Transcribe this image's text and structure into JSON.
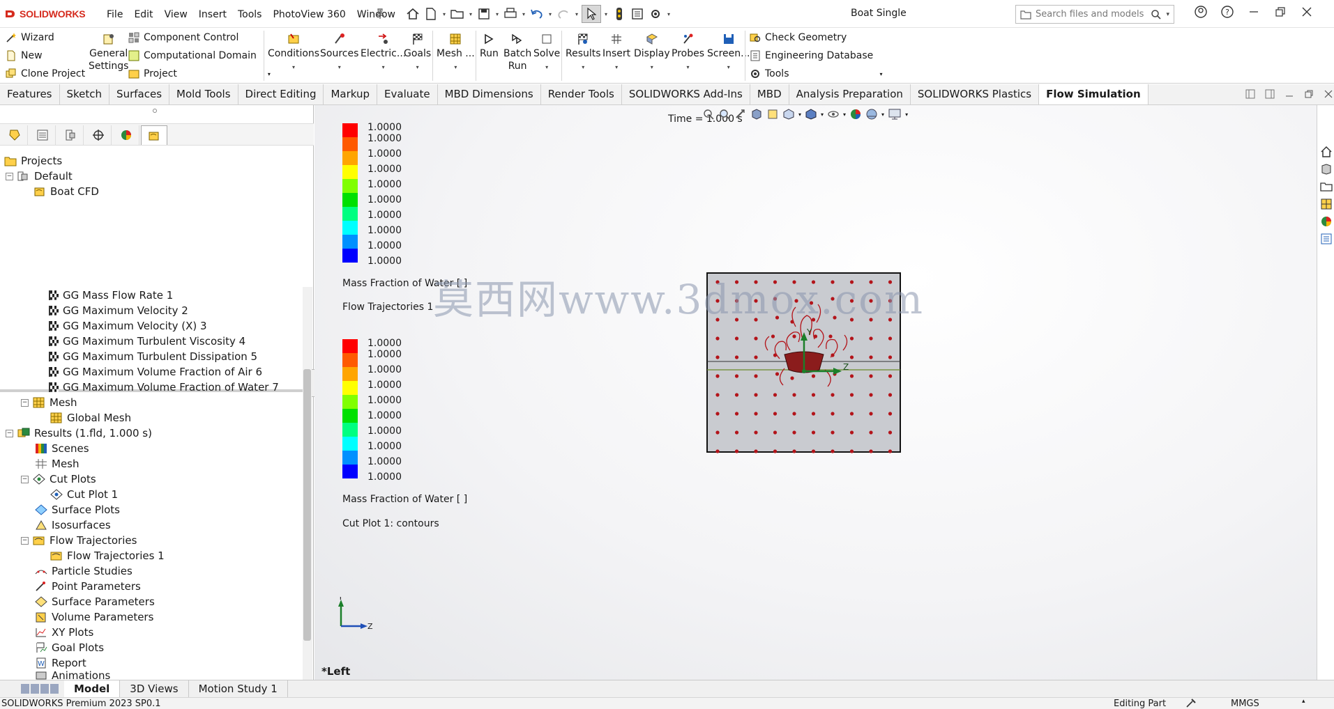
{
  "app": {
    "logo_text": "SOLIDWORKS",
    "document_title": "Boat Single"
  },
  "menu": [
    "File",
    "Edit",
    "View",
    "Insert",
    "Tools",
    "PhotoView 360",
    "Window"
  ],
  "search": {
    "placeholder": "Search files and models"
  },
  "command_manager": {
    "wizard": "Wizard",
    "new": "New",
    "clone_project": "Clone Project",
    "general_settings_line1": "General",
    "general_settings_line2": "Settings",
    "component_control": "Component Control",
    "computational_domain": "Computational Domain",
    "project": "Project",
    "conditions": "Conditions",
    "sources": "Sources",
    "electric": "Electric...",
    "goals": "Goals",
    "mesh": "Mesh ...",
    "run": "Run",
    "batch_run_line1": "Batch",
    "batch_run_line2": "Run",
    "solve": "Solve",
    "results": "Results",
    "insert": "Insert",
    "display": "Display",
    "probes": "Probes",
    "screen": "Screen...",
    "check_geometry": "Check Geometry",
    "engineering_database": "Engineering Database",
    "tools": "Tools"
  },
  "tabs": [
    "Features",
    "Sketch",
    "Surfaces",
    "Mold Tools",
    "Direct Editing",
    "Markup",
    "Evaluate",
    "MBD Dimensions",
    "Render Tools",
    "SOLIDWORKS Add-Ins",
    "MBD",
    "Analysis Preparation",
    "SOLIDWORKS Plastics",
    "Flow Simulation"
  ],
  "active_tab": "Flow Simulation",
  "projects_tree": {
    "root": "Projects",
    "default": "Default",
    "project": "Boat CFD"
  },
  "analysis_tree": {
    "goals": [
      "GG Mass Flow Rate 1",
      "GG Maximum Velocity 2",
      "GG Maximum Velocity (X) 3",
      "GG Maximum Turbulent Viscosity 4",
      "GG Maximum Turbulent Dissipation 5",
      "GG Maximum Volume Fraction of Air 6",
      "GG Maximum Volume Fraction of Water 7"
    ],
    "mesh": "Mesh",
    "global_mesh": "Global Mesh",
    "results": "Results (1.fld, 1.000 s)",
    "scenes": "Scenes",
    "results_mesh": "Mesh",
    "cut_plots": "Cut Plots",
    "cut_plot_1": "Cut Plot 1",
    "surface_plots": "Surface Plots",
    "isosurfaces": "Isosurfaces",
    "flow_trajectories": "Flow Trajectories",
    "flow_trajectories_1": "Flow Trajectories 1",
    "particle_studies": "Particle Studies",
    "point_parameters": "Point Parameters",
    "surface_parameters": "Surface Parameters",
    "volume_parameters": "Volume Parameters",
    "xy_plots": "XY Plots",
    "goal_plots": "Goal Plots",
    "report": "Report",
    "animations": "Animations"
  },
  "viewport": {
    "time_label": "Time = 1.000 s",
    "legend_1": {
      "ticks": [
        "1.0000",
        "1.0000",
        "1.0000",
        "1.0000",
        "1.0000",
        "1.0000",
        "1.0000",
        "1.0000",
        "1.0000",
        "1.0000"
      ],
      "label": "Mass Fraction of Water [ ]",
      "caption": "Flow Trajectories 1"
    },
    "legend_2": {
      "ticks": [
        "1.0000",
        "1.0000",
        "1.0000",
        "1.0000",
        "1.0000",
        "1.0000",
        "1.0000",
        "1.0000",
        "1.0000",
        "1.0000"
      ],
      "label": "Mass Fraction of Water [ ]",
      "caption": "Cut Plot 1: contours"
    },
    "legend_colors": [
      "#ff0000",
      "#ff5a00",
      "#ffa500",
      "#ffff00",
      "#80ff00",
      "#00e000",
      "#00ff80",
      "#00ffff",
      "#0090ff",
      "#0000ff"
    ],
    "watermark": "莫西网www.3dmox.com",
    "axis_y": "Y",
    "axis_z": "Z",
    "view_name": "*Left"
  },
  "bottom_tabs": [
    "Model",
    "3D Views",
    "Motion Study 1"
  ],
  "active_bottom_tab": "Model",
  "status": {
    "version": "SOLIDWORKS Premium 2023 SP0.1",
    "mode": "Editing Part",
    "units": "MMGS"
  }
}
